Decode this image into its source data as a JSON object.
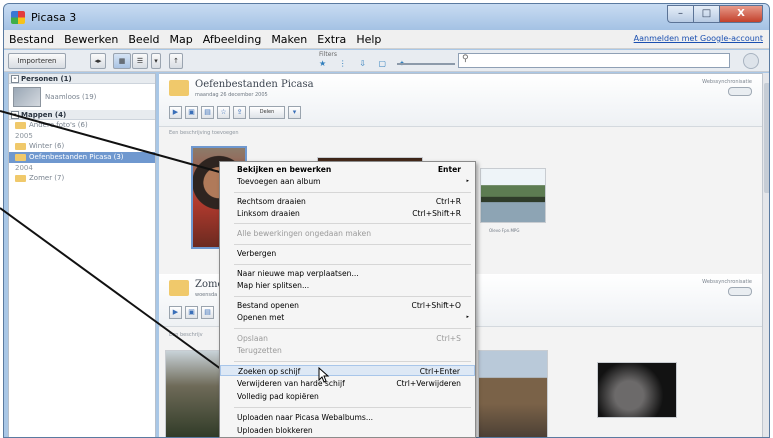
{
  "window": {
    "title": "Picasa 3",
    "buttons": [
      "–",
      "□",
      "X"
    ]
  },
  "menubar": {
    "items": [
      "Bestand",
      "Bewerken",
      "Beeld",
      "Map",
      "Afbeelding",
      "Maken",
      "Extra",
      "Help"
    ],
    "account_link": "Aanmelden met Google-account"
  },
  "toolbar": {
    "import_label": "Importeren",
    "filter_label": "Filters",
    "filter_icons": "★ ⋮ ⇩ ▢ ✦"
  },
  "sidebar": {
    "people_header": "Personen (1)",
    "people_item": "Naamloos (19)",
    "folders_header": "Mappen (4)",
    "items": [
      {
        "label": "Andere foto's (6)",
        "year": ""
      },
      {
        "label": "",
        "year": "2005"
      },
      {
        "label": "Winter (6)",
        "year": ""
      },
      {
        "label": "Oefenbestanden Picasa (3)",
        "year": "",
        "selected": true
      },
      {
        "label": "",
        "year": "2004"
      },
      {
        "label": "Zomer (7)",
        "year": ""
      }
    ]
  },
  "albums": [
    {
      "title": "Oefenbestanden Picasa",
      "date": "maandag 26 december 2005",
      "sync_label": "Webssynchronisatie",
      "share_label": "Delen",
      "description": "Een beschrijving toevoegen",
      "caption": "Olevo Fpn.MPG"
    },
    {
      "title": "Zome",
      "date": "woensda",
      "sync_label": "Webssynchronisatie",
      "description": "Een beschrijv"
    }
  ],
  "context_menu": {
    "items": [
      {
        "label": "Bekijken en bewerken",
        "shortcut": "Enter",
        "bold": true
      },
      {
        "label": "Toevoegen aan album",
        "submenu": true
      },
      {
        "label": "Rechtsom draaien",
        "shortcut": "Ctrl+R"
      },
      {
        "label": "Linksom draaien",
        "shortcut": "Ctrl+Shift+R"
      },
      {
        "label": "Alle bewerkingen ongedaan maken",
        "disabled": true
      },
      {
        "label": "Verbergen"
      },
      {
        "label": "Naar nieuwe map verplaatsen..."
      },
      {
        "label": "Map hier splitsen..."
      },
      {
        "label": "Bestand openen",
        "shortcut": "Ctrl+Shift+O"
      },
      {
        "label": "Openen met",
        "submenu": true
      },
      {
        "label": "Opslaan",
        "shortcut": "Ctrl+S",
        "disabled": true
      },
      {
        "label": "Terugzetten",
        "disabled": true
      },
      {
        "label": "Zoeken op schijf",
        "shortcut": "Ctrl+Enter",
        "hover": true
      },
      {
        "label": "Verwijderen van harde schijf",
        "shortcut": "Ctrl+Verwijderen"
      },
      {
        "label": "Volledig pad kopiëren"
      },
      {
        "label": "Uploaden naar Picasa Webalbums..."
      },
      {
        "label": "Uploaden blokkeren"
      }
    ]
  }
}
